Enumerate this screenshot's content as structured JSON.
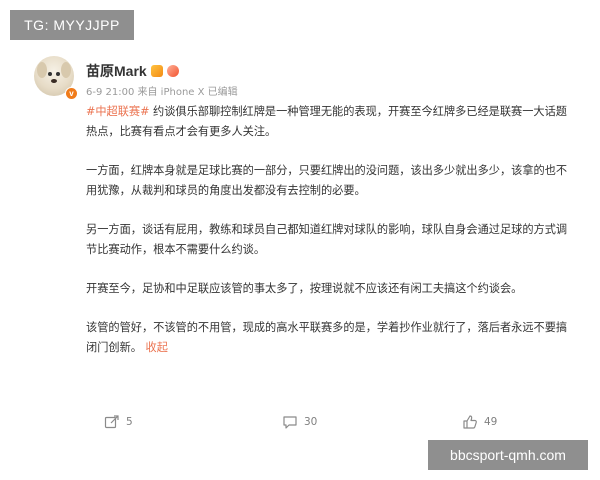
{
  "watermark_top": "TG: MYYJJPP",
  "watermark_bottom": "bbcsport-qmh.com",
  "post": {
    "author": "苗原Mark",
    "meta": "6-9 21:00 来自 iPhone X 已编辑",
    "hashtag": "#中超联赛#",
    "paragraphs": [
      " 约谈俱乐部聊控制红牌是一种管理无能的表现，开赛至今红牌多已经是联赛一大话题热点，比赛有看点才会有更多人关注。",
      "一方面，红牌本身就是足球比赛的一部分，只要红牌出的没问题，该出多少就出多少，该拿的也不用犹豫，从裁判和球员的角度出发都没有去控制的必要。",
      "另一方面，谈话有屁用，教练和球员自己都知道红牌对球队的影响，球队自身会通过足球的方式调节比赛动作，根本不需要什么约谈。",
      "开赛至今，足协和中足联应该管的事太多了，按理说就不应该还有闲工夫搞这个约谈会。",
      "该管的管好，不该管的不用管，现成的高水平联赛多的是，学着抄作业就行了，落后者永远不要搞闭门创新。"
    ],
    "collapse_label": "收起",
    "actions": {
      "share_count": "5",
      "comment_count": "30",
      "like_count": "49"
    }
  },
  "colors": {
    "accent": "#eb7350",
    "verified": "#f07b1a",
    "watermark_bg": "#8f8f8f"
  },
  "icons": [
    "share-icon",
    "comment-icon",
    "like-icon",
    "verified-icon"
  ]
}
